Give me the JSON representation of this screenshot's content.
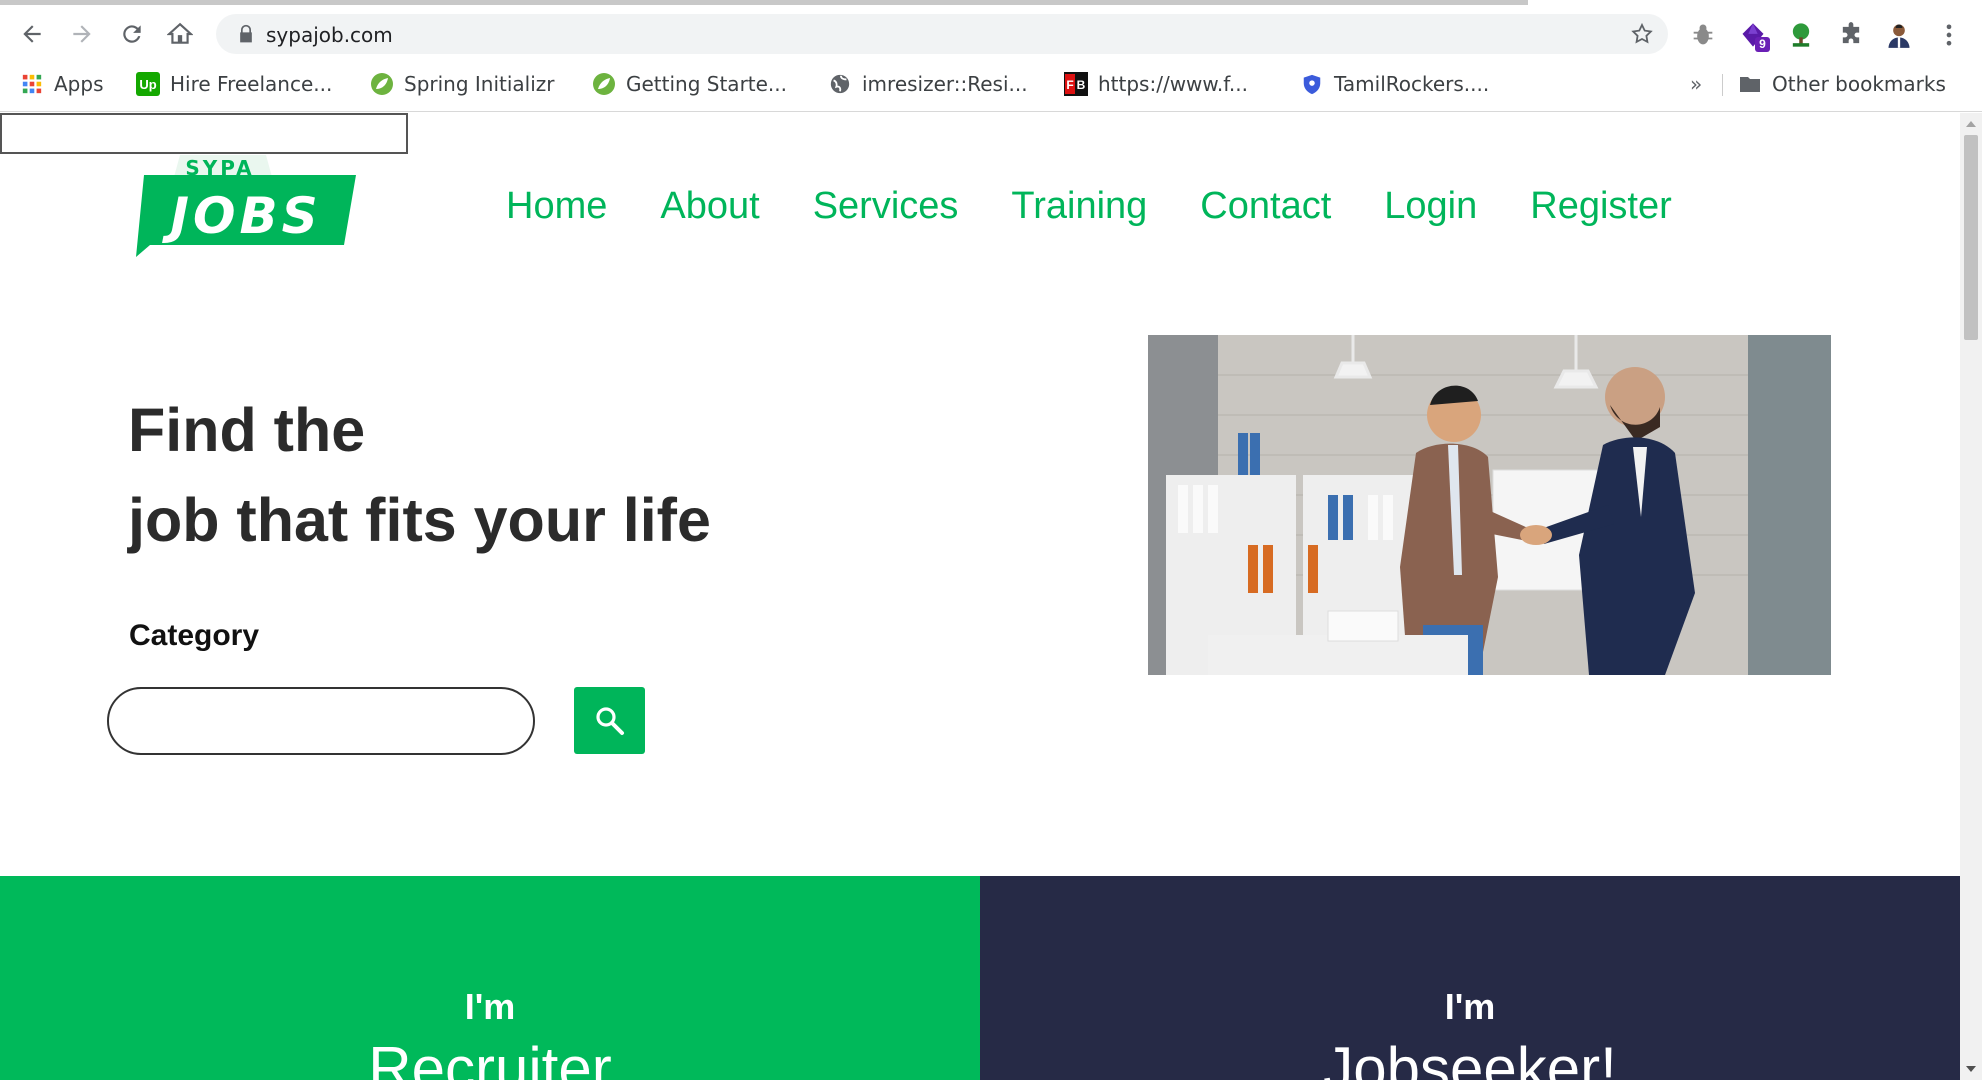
{
  "browser": {
    "url": "sypajob.com",
    "extension_badge": "9",
    "bookmarks": [
      {
        "label": "Apps",
        "icon": "apps-grid-icon"
      },
      {
        "label": "Hire Freelance...",
        "icon": "upwork-icon"
      },
      {
        "label": "Spring Initializr",
        "icon": "spring-leaf-icon"
      },
      {
        "label": "Getting Starte...",
        "icon": "spring-leaf-icon"
      },
      {
        "label": "imresizer::Resi...",
        "icon": "globe-icon"
      },
      {
        "label": "https://www.f...",
        "icon": "fb-icon"
      },
      {
        "label": "TamilRockers....",
        "icon": "shield-icon"
      }
    ],
    "overflow_label": "»",
    "other_bookmarks": "Other bookmarks"
  },
  "site": {
    "logo_top": "SYPA",
    "logo_main": "JOBS",
    "nav": [
      "Home",
      "About",
      "Services",
      "Training",
      "Contact",
      "Login",
      "Register"
    ],
    "hero_line1": "Find the",
    "hero_line2": "job that fits your life",
    "category_label": "Category",
    "category_value": "",
    "panels": {
      "left_im": "I'm",
      "left_role": "Recruiter",
      "right_im": "I'm",
      "right_role": "Jobseeker!"
    }
  },
  "colors": {
    "brand_green": "#00b55a",
    "panel_green": "#00b95a",
    "panel_navy": "#262a46"
  }
}
